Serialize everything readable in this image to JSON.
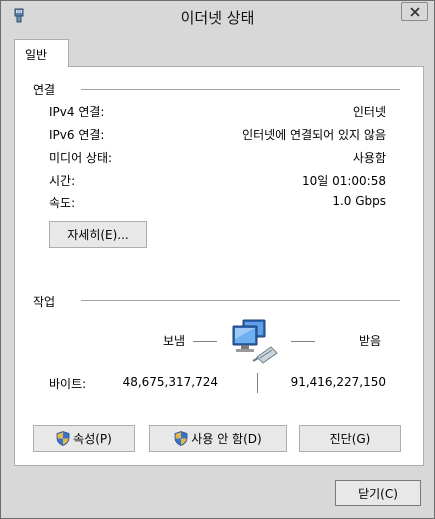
{
  "window": {
    "title": "이더넷 상태"
  },
  "tabs": [
    {
      "label": "일반"
    }
  ],
  "connection": {
    "heading": "연결",
    "rows": [
      {
        "label": "IPv4 연결:",
        "value": "인터넷"
      },
      {
        "label": "IPv6 연결:",
        "value": "인터넷에 연결되어 있지 않음"
      },
      {
        "label": "미디어 상태:",
        "value": "사용함"
      },
      {
        "label": "시간:",
        "value": "10일 01:00:58"
      },
      {
        "label": "속도:",
        "value": "1.0 Gbps"
      }
    ],
    "details_button": "자세히(E)..."
  },
  "activity": {
    "heading": "작업",
    "sent_label": "보냄",
    "received_label": "받음",
    "bytes_label": "바이트:",
    "bytes_sent": "48,675,317,724",
    "bytes_received": "91,416,227,150"
  },
  "buttons": {
    "properties": "속성(P)",
    "disable": "사용 안 함(D)",
    "diagnose": "진단(G)",
    "close": "닫기(C)"
  },
  "icons": {
    "app": "network-adapter-icon",
    "close": "close-icon",
    "network": "network-activity-icon",
    "shield": "uac-shield-icon"
  }
}
